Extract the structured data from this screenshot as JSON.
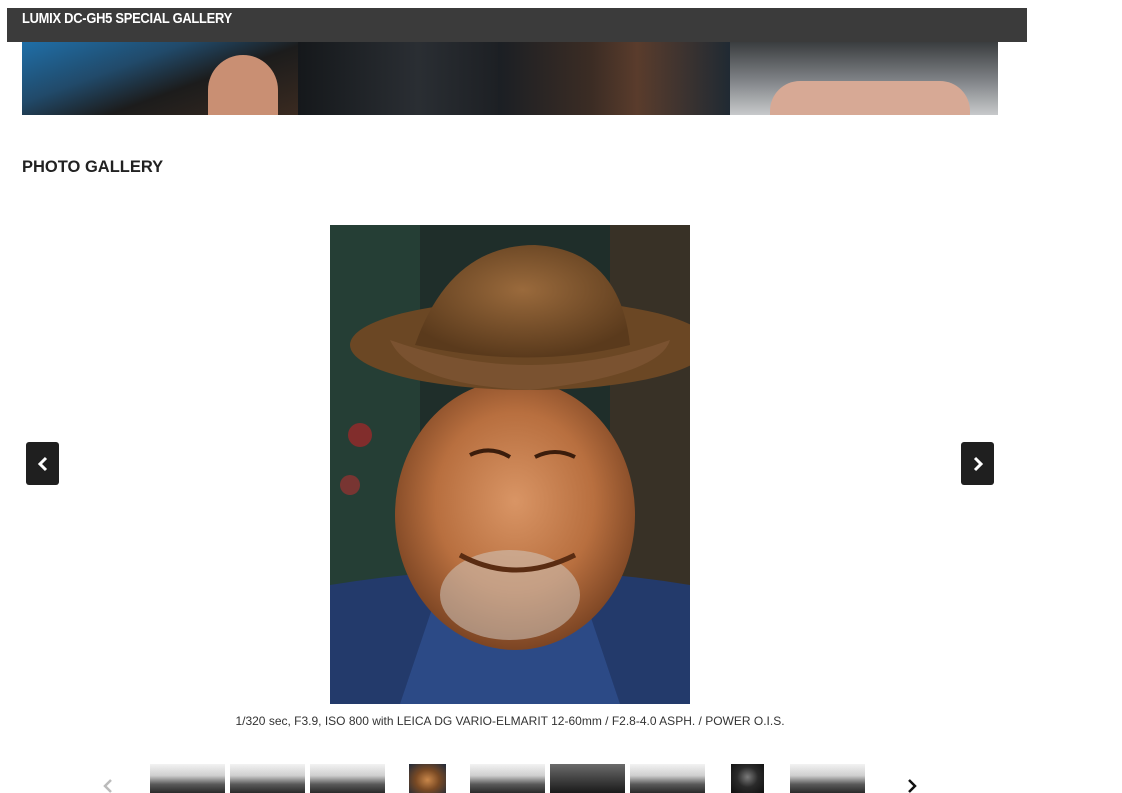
{
  "header": {
    "title": "LUMIX DC-GH5 SPECIAL GALLERY"
  },
  "gallery": {
    "section_title": "PHOTO GALLERY",
    "caption": "1/320 sec, F3.9, ISO 800 with LEICA DG VARIO-ELMARIT 12-60mm / F2.8-4.0 ASPH. / POWER O.I.S.",
    "prev_icon": "chevron-left-icon",
    "next_icon": "chevron-right-icon"
  },
  "thumbnails": {
    "prev_icon": "chevron-left-icon",
    "next_icon": "chevron-right-icon",
    "items": [
      {
        "tone": "bw"
      },
      {
        "tone": "bw"
      },
      {
        "tone": "bw"
      },
      {
        "tone": "color"
      },
      {
        "tone": "bw"
      },
      {
        "tone": "dark"
      },
      {
        "tone": "bw"
      },
      {
        "tone": "portrait"
      },
      {
        "tone": "bw"
      }
    ]
  },
  "colors": {
    "header_bg": "#3b3b3b",
    "nav_button_bg": "#1f1f1f"
  }
}
